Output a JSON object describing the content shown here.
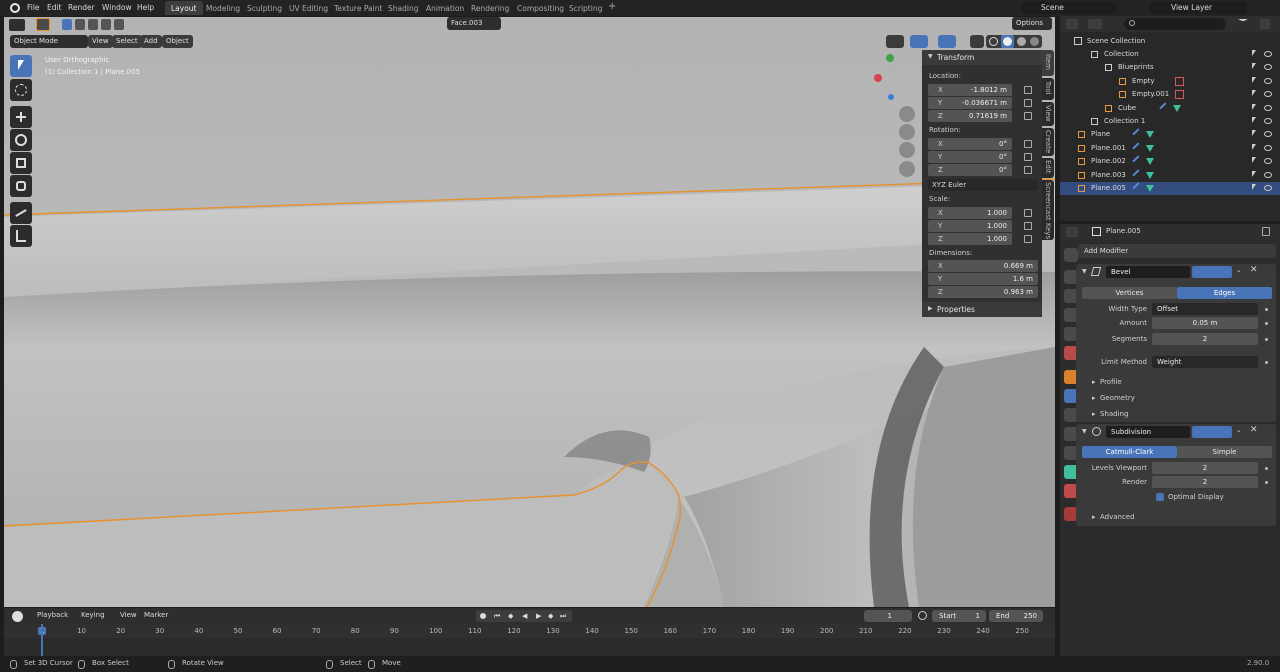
{
  "app": {
    "menu": [
      "File",
      "Edit",
      "Render",
      "Window",
      "Help"
    ],
    "workspaces": [
      "Layout",
      "Modeling",
      "Sculpting",
      "UV Editing",
      "Texture Paint",
      "Shading",
      "Animation",
      "Rendering",
      "Compositing",
      "Scripting"
    ],
    "active_workspace": "Layout",
    "scene": "Scene",
    "view_layer": "View Layer"
  },
  "viewport": {
    "mode": "Object Mode",
    "header_menus": [
      "View",
      "Select",
      "Add",
      "Object"
    ],
    "orientation_field": "Face.003",
    "options_label": "Options",
    "overlay_title": "User Orthographic",
    "overlay_subtitle": "(1) Collection 1 | Plane.005"
  },
  "npanel": {
    "section": "Transform",
    "location_label": "Location:",
    "location": [
      {
        "k": "X",
        "v": "-1.8012 m"
      },
      {
        "k": "Y",
        "v": "-0.036671 m"
      },
      {
        "k": "Z",
        "v": "0.71619 m"
      }
    ],
    "rotation_label": "Rotation:",
    "rotation": [
      {
        "k": "X",
        "v": "0°"
      },
      {
        "k": "Y",
        "v": "0°"
      },
      {
        "k": "Z",
        "v": "0°"
      }
    ],
    "rotation_mode": "XYZ Euler",
    "scale_label": "Scale:",
    "scale": [
      {
        "k": "X",
        "v": "1.000"
      },
      {
        "k": "Y",
        "v": "1.000"
      },
      {
        "k": "Z",
        "v": "1.000"
      }
    ],
    "dimensions_label": "Dimensions:",
    "dimensions": [
      {
        "k": "X",
        "v": "0.669 m"
      },
      {
        "k": "Y",
        "v": "1.6 m"
      },
      {
        "k": "Z",
        "v": "0.963 m"
      }
    ],
    "properties_section": "Properties",
    "tabs": [
      "Item",
      "Tool",
      "View",
      "Create",
      "Edit",
      "Screencast Keys"
    ]
  },
  "outliner": {
    "root": "Scene Collection",
    "items": [
      {
        "label": "Collection"
      },
      {
        "label": "Blueprints"
      },
      {
        "label": "Empty"
      },
      {
        "label": "Empty.001"
      },
      {
        "label": "Cube"
      },
      {
        "label": "Collection 1"
      },
      {
        "label": "Plane"
      },
      {
        "label": "Plane.001"
      },
      {
        "label": "Plane.002"
      },
      {
        "label": "Plane.003"
      },
      {
        "label": "Plane.005"
      }
    ],
    "selected": "Plane.005"
  },
  "properties": {
    "object_name": "Plane.005",
    "add_modifier": "Add Modifier",
    "bevel": {
      "name": "Bevel",
      "mode_a": "Vertices",
      "mode_b": "Edges",
      "width_type_label": "Width Type",
      "width_type": "Offset",
      "amount_label": "Amount",
      "amount": "0.05 m",
      "segments_label": "Segments",
      "segments": "2",
      "limit_method_label": "Limit Method",
      "limit_method": "Weight",
      "subpanels": [
        "Profile",
        "Geometry",
        "Shading"
      ]
    },
    "subdivision": {
      "name": "Subdivision",
      "mode_a": "Catmull-Clark",
      "mode_b": "Simple",
      "levels_viewport_label": "Levels Viewport",
      "levels_viewport": "2",
      "render_label": "Render",
      "render": "2",
      "optimal_display": "Optimal Display",
      "advanced": "Advanced"
    }
  },
  "timeline": {
    "menus": [
      "Playback",
      "Keying",
      "View",
      "Marker"
    ],
    "current_frame": "1",
    "start_label": "Start",
    "start": "1",
    "end_label": "End",
    "end": "250",
    "ruler": [
      "1",
      "10",
      "20",
      "30",
      "40",
      "50",
      "60",
      "70",
      "80",
      "90",
      "100",
      "110",
      "120",
      "130",
      "140",
      "150",
      "160",
      "170",
      "180",
      "190",
      "200",
      "210",
      "220",
      "230",
      "240",
      "250"
    ]
  },
  "statusbar": {
    "items": [
      "Set 3D Cursor",
      "Box Select",
      "Rotate View",
      "Select",
      "Move"
    ],
    "version": "2.90.0"
  },
  "colors": {
    "accent": "#4772b3",
    "selection_outline": "#e8902a",
    "object_orange": "#e89a3c",
    "mesh_green": "#3fbf9c"
  }
}
